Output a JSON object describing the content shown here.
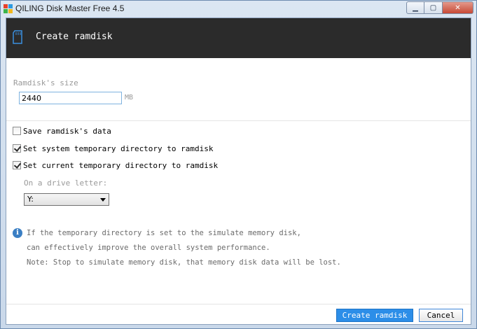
{
  "window": {
    "title": "QILING Disk Master Free 4.5",
    "controls": {
      "minimize": "▁",
      "maximize": "▢",
      "close": "✕"
    }
  },
  "header": {
    "title": "Create ramdisk",
    "icon": "sd-card-icon"
  },
  "size": {
    "label": "Ramdisk's size",
    "value": "2440",
    "unit": "MB"
  },
  "options": [
    {
      "label": "Save ramdisk's data",
      "checked": false
    },
    {
      "label": "Set system temporary directory to ramdisk",
      "checked": true
    },
    {
      "label": "Set current temporary directory to ramdisk",
      "checked": true
    }
  ],
  "drive": {
    "label": "On a drive letter:",
    "selected": "Y:"
  },
  "info": {
    "icon": "info-icon",
    "lines": [
      "If the temporary directory is set to the simulate memory disk,",
      "can effectively improve the overall system performance.",
      "Note: Stop to simulate memory disk, that memory disk data will be lost."
    ]
  },
  "buttons": {
    "create": "Create ramdisk",
    "cancel": "Cancel"
  },
  "colors": {
    "header_bg": "#2b2b2b",
    "primary": "#2c8ee8",
    "info": "#3b7fc4"
  }
}
